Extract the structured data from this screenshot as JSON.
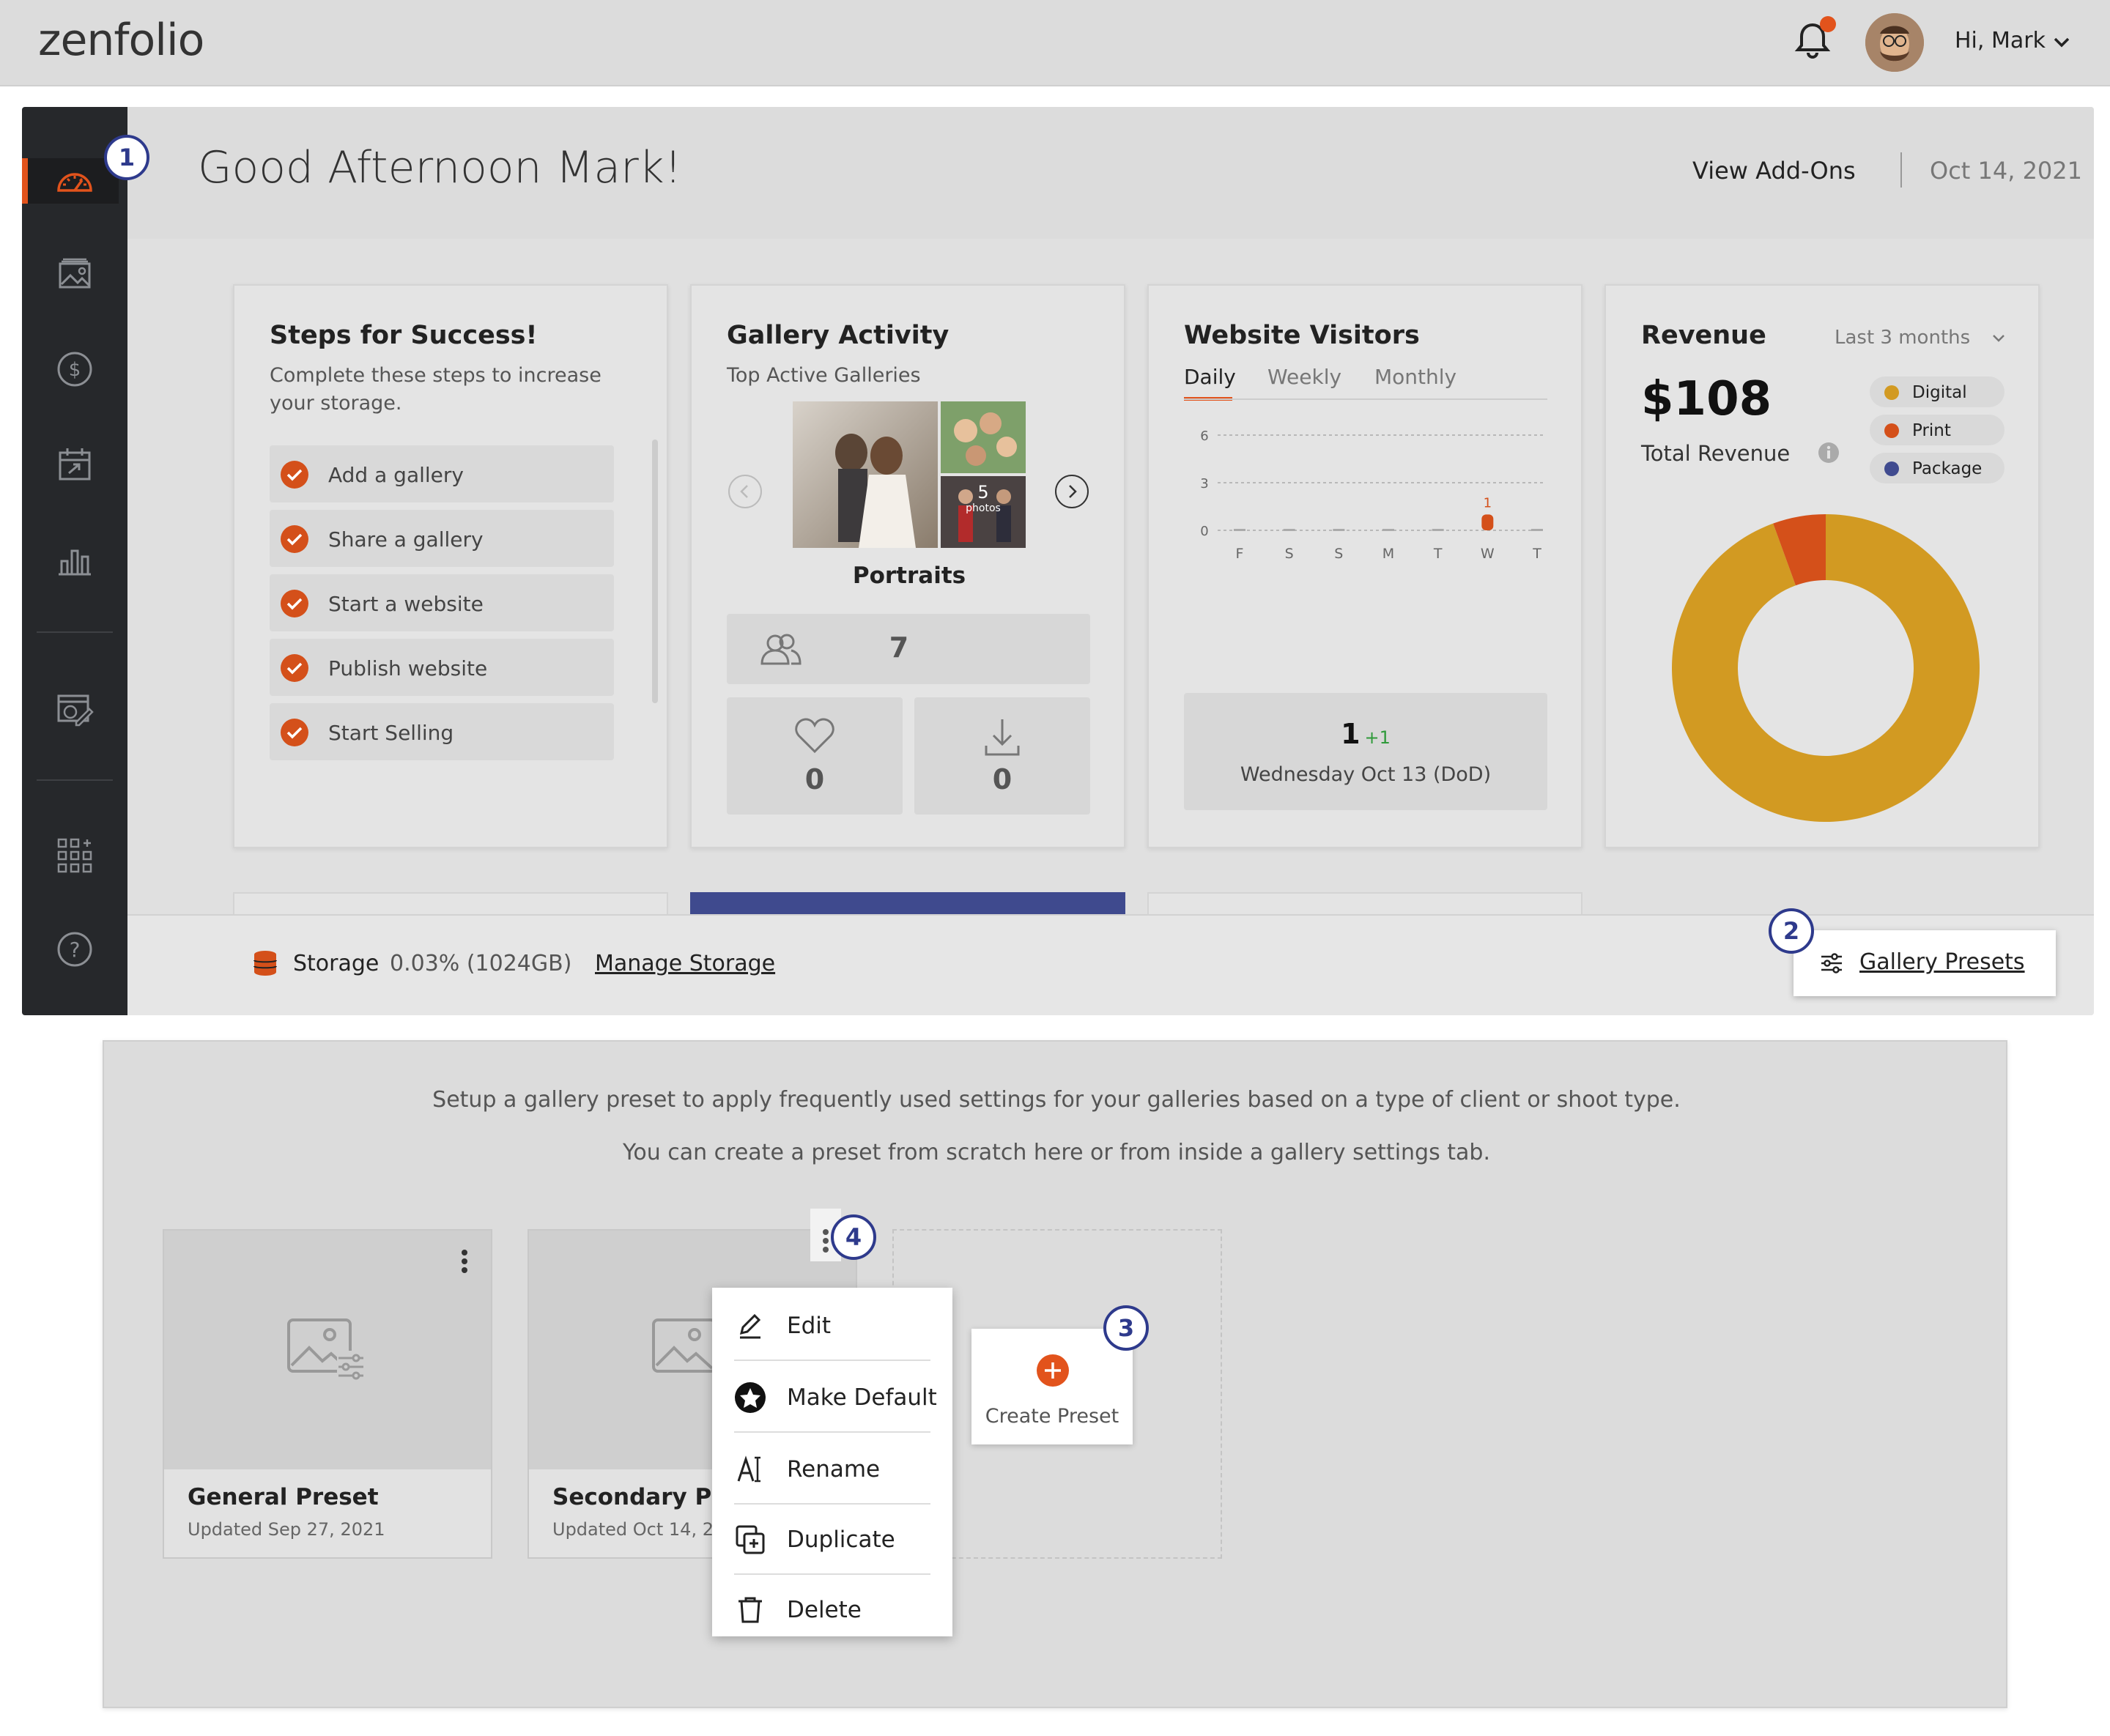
{
  "brand": {
    "logo_text": "zenfolio",
    "accent": "#e2531c"
  },
  "topbar": {
    "greeting": "Hi, Mark",
    "notifications_icon": "bell-icon",
    "has_notification_dot": true
  },
  "sidebar": {
    "items": [
      {
        "icon": "speedometer-icon",
        "active": true
      },
      {
        "icon": "galleries-icon"
      },
      {
        "icon": "dollar-icon"
      },
      {
        "icon": "calendar-icon"
      },
      {
        "icon": "bar-chart-icon"
      },
      {
        "icon": "website-edit-icon"
      },
      {
        "icon": "apps-grid-icon"
      },
      {
        "icon": "help-icon"
      }
    ]
  },
  "header": {
    "title": "Good Afternoon Mark!",
    "view_addons": "View Add-Ons",
    "date": "Oct 14, 2021"
  },
  "steps_card": {
    "title": "Steps for Success!",
    "subtitle": "Complete these steps to increase your storage.",
    "steps": [
      "Add a gallery",
      "Share a gallery",
      "Start a website",
      "Publish website",
      "Start Selling"
    ]
  },
  "gallery_card": {
    "title": "Gallery Activity",
    "subtitle": "Top Active Galleries",
    "gallery_name": "Portraits",
    "photos_count": "5",
    "photos_label": "photos",
    "visitors": "7",
    "favorites": "0",
    "downloads": "0"
  },
  "visitors_card": {
    "title": "Website Visitors",
    "tabs": [
      "Daily",
      "Weekly",
      "Monthly"
    ],
    "active_tab": "Daily",
    "summary_value": "1",
    "summary_delta": "+1",
    "summary_label": "Wednesday Oct 13 (DoD)"
  },
  "revenue_card": {
    "title": "Revenue",
    "period": "Last 3 months",
    "amount": "$108",
    "amount_label": "Total Revenue",
    "legend": [
      {
        "name": "Digital",
        "color": "#d29a22"
      },
      {
        "name": "Print",
        "color": "#d4501a"
      },
      {
        "name": "Package",
        "color": "#404b8f"
      }
    ]
  },
  "chart_data": [
    {
      "type": "bar",
      "title": "Website Visitors",
      "categories": [
        "F",
        "S",
        "S",
        "M",
        "T",
        "W",
        "T"
      ],
      "values": [
        0,
        0,
        0,
        0,
        0,
        1,
        0
      ],
      "ylim": [
        0,
        6
      ],
      "yticks": [
        0,
        3,
        6
      ],
      "data_labels": [
        "",
        "",
        "",
        "",
        "",
        "1",
        ""
      ],
      "grid": true
    },
    {
      "type": "pie",
      "title": "Revenue",
      "labels": [
        "Digital",
        "Print",
        "Package"
      ],
      "values": [
        102,
        6,
        0
      ],
      "colors": [
        "#d29a22",
        "#d4501a",
        "#404b8f"
      ],
      "donut": true
    }
  ],
  "storage": {
    "label": "Storage",
    "usage": "0.03% (1024GB)",
    "manage_link": "Manage Storage",
    "gallery_presets": "Gallery Presets"
  },
  "presets": {
    "intro_line1": "Setup a gallery preset to apply frequently used settings for your galleries based on a type of client or shoot type.",
    "intro_line2": "You can create a preset from scratch here or from inside a gallery settings tab.",
    "cards": [
      {
        "name": "General Preset",
        "updated": "Updated Sep 27, 2021"
      },
      {
        "name": "Secondary Pres",
        "updated": "Updated Oct 14, 202"
      }
    ],
    "create_label": "Create Preset",
    "menu": [
      "Edit",
      "Make Default",
      "Rename",
      "Duplicate",
      "Delete"
    ]
  },
  "callouts": [
    "1",
    "2",
    "3",
    "4"
  ]
}
